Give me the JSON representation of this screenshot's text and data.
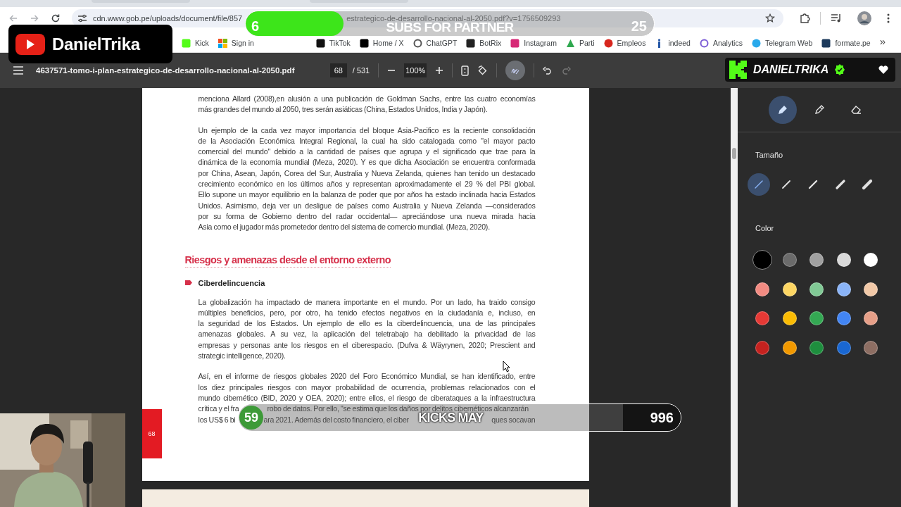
{
  "browser": {
    "nav": [
      {
        "kind": "back",
        "disabled": true
      },
      {
        "kind": "forward",
        "disabled": true
      },
      {
        "kind": "reload",
        "disabled": false
      }
    ],
    "url_start": "cdn.www.gob.pe/uploads/document/file/857",
    "url_end": "estrategico-de-desarrollo-nacional-al-2050.pdf?v=1756509293",
    "bookmarks": [
      {
        "label": "Kick",
        "kind": "kick"
      },
      {
        "label": "Sign in",
        "kind": "microsoft"
      },
      {
        "label": "TikTok",
        "kind": "tiktok"
      },
      {
        "label": "Home / X",
        "kind": "x"
      },
      {
        "label": "ChatGPT",
        "kind": "chatgpt"
      },
      {
        "label": "BotRix",
        "kind": "botrix"
      },
      {
        "label": "Instagram",
        "kind": "instagram"
      },
      {
        "label": "Parti",
        "kind": "parti"
      },
      {
        "label": "Empleos",
        "kind": "empleos"
      },
      {
        "label": "indeed",
        "kind": "indeed"
      },
      {
        "label": "Analytics",
        "kind": "analytics"
      },
      {
        "label": "Telegram Web",
        "kind": "telegram"
      },
      {
        "label": "formate.pe",
        "kind": "formate"
      }
    ],
    "more_bookmarks": "»"
  },
  "pdf_toolbar": {
    "filename": "4637571-tomo-i-plan-estrategico-de-desarrollo-nacional-al-2050.pdf",
    "page": "68",
    "page_total": "/ 531",
    "zoom": "100%",
    "draw_mode": true,
    "redo_disabled": true
  },
  "document": {
    "blocks": [
      {
        "kind": "paragraph",
        "lines": [
          [
            "menciona Allard (2008),en alusión a una publicación de Goldman Sachs, entre las cuatro economías"
          ],
          [
            "más grandes del mundo al 2050, tres serán asiáticas (China, Estados Unidos, India y Japón)."
          ]
        ]
      },
      {
        "kind": "paragraph",
        "lines": [
          [
            "Un ejemplo de la cada vez mayor importancia del bloque Asia-Pacifico es la reciente consolidación"
          ],
          [
            "de la Asociación Económica Integral Regional, la cual ha sido catalogada como \"el mayor pacto"
          ],
          [
            "comercial del mundo\" debido a la cantidad de países que agrupa y el significado que trae para la"
          ],
          [
            "dinámica de la economía mundial (Meza, 2020). Y es que dicha Asociación se encuentra conformada"
          ],
          [
            "por China, Asean, Japón, Corea del Sur, Australia y Nueva Zelanda, quienes han tenido un destacado"
          ],
          [
            "crecimiento económico en los últimos años y representan aproximadamente el 29 % del PBI global."
          ],
          [
            "Ello supone un mayor equilibrio en la balanza de poder que por años ha estado inclinada hacia Estados"
          ],
          [
            "Unidos. Asimismo, deja ver un desligue de países como Australia y Nueva Zelanda —considerados"
          ],
          [
            "por su forma de Gobierno dentro del radar occidental— apreciándose una nueva mirada hacia"
          ],
          [
            "Asia como el jugador más prometedor dentro del sistema de comercio mundial. (Meza, 2020)."
          ]
        ]
      },
      {
        "kind": "heading",
        "text": "Riesgos y amenazas desde el entorno externo"
      },
      {
        "kind": "bullet",
        "text": "Ciberdelincuencia"
      },
      {
        "kind": "paragraph",
        "lines": [
          [
            "La globalización ha impactado de manera importante en el mundo. Por un lado, ha traido consigo"
          ],
          [
            "múltiples beneficios, pero, por otro, ha tenido efectos negativos en la ciudadanía e, incluso, en"
          ],
          [
            "la seguridad de los Estados. Un ejemplo de ello es la ciberdelincuencia, una de las principales"
          ],
          [
            "amenazas globales. A su vez, la aplicación del teletrabajo ha debilitado la privacidad de las"
          ],
          [
            "empresas y personas ante los riesgos en el ciberespacio. (Dufva & Wäyrynen, 2020; Prescient and"
          ],
          [
            "strategic intelligence, 2020)."
          ]
        ]
      },
      {
        "kind": "paragraph",
        "lines": [
          [
            "Así, en el informe de riesgos globales 2020 del Foro Económico Mundial, se han identificado, entre"
          ],
          [
            "los diez principales riesgos con mayor probabilidad de ocurrencia, problemas relacionados con el"
          ],
          [
            "mundo cibernético (BID, 2020 y OEA, 2020); entre ellos, el riesgo de ciberataques a la infraestructura"
          ],
          [
            "crítica y el fra",
            "robo de datos. Por ello, \"se estima que los daños por delitos cibernéticos alcanzarán"
          ],
          [
            "los US$ 6 bi",
            "ara 2021. Además del costo financiero, el ciber",
            "ques socavan"
          ]
        ]
      }
    ],
    "page_number": "68"
  },
  "annotation_panel": {
    "tools": [
      {
        "kind": "pen",
        "selected": true
      },
      {
        "kind": "pencil",
        "selected": false
      },
      {
        "kind": "eraser",
        "selected": false
      }
    ],
    "size_label": "Tamaño",
    "sizes": [
      {
        "selected": true
      },
      {
        "selected": false
      },
      {
        "selected": false
      },
      {
        "selected": false
      },
      {
        "selected": false
      }
    ],
    "color_label": "Color",
    "colors": [
      {
        "color": "#000000",
        "selected": true
      },
      {
        "color": "#6b6b6b",
        "selected": false
      },
      {
        "color": "#a0a0a0",
        "selected": false
      },
      {
        "color": "#d9d9d9",
        "selected": false
      },
      {
        "color": "#ffffff",
        "selected": false
      },
      {
        "color": "#f28b82",
        "selected": false
      },
      {
        "color": "#fdd663",
        "selected": false
      },
      {
        "color": "#81c995",
        "selected": false
      },
      {
        "color": "#8ab4f8",
        "selected": false
      },
      {
        "color": "#f2c9a8",
        "selected": false
      },
      {
        "color": "#e53935",
        "selected": false
      },
      {
        "color": "#fbbc04",
        "selected": false
      },
      {
        "color": "#34a853",
        "selected": false
      },
      {
        "color": "#4285f4",
        "selected": false
      },
      {
        "color": "#e69f88",
        "selected": false
      },
      {
        "color": "#c5221f",
        "selected": false
      },
      {
        "color": "#f29900",
        "selected": false
      },
      {
        "color": "#1e8e3e",
        "selected": false
      },
      {
        "color": "#1967d2",
        "selected": false
      },
      {
        "color": "#8d6e63",
        "selected": false
      }
    ]
  },
  "overlays": {
    "channel_badge": {
      "name": "DanielTrika"
    },
    "subs_goal": {
      "current": "6",
      "label": "SUBS FOR PARTNER",
      "target": "25",
      "level": 0.24
    },
    "kick_badge": {
      "name": "DANIELTRIKA",
      "verified": true
    },
    "kicks_goal": {
      "current": "59",
      "label": "KICKS MAY",
      "target": "996",
      "level": 0.87
    }
  }
}
